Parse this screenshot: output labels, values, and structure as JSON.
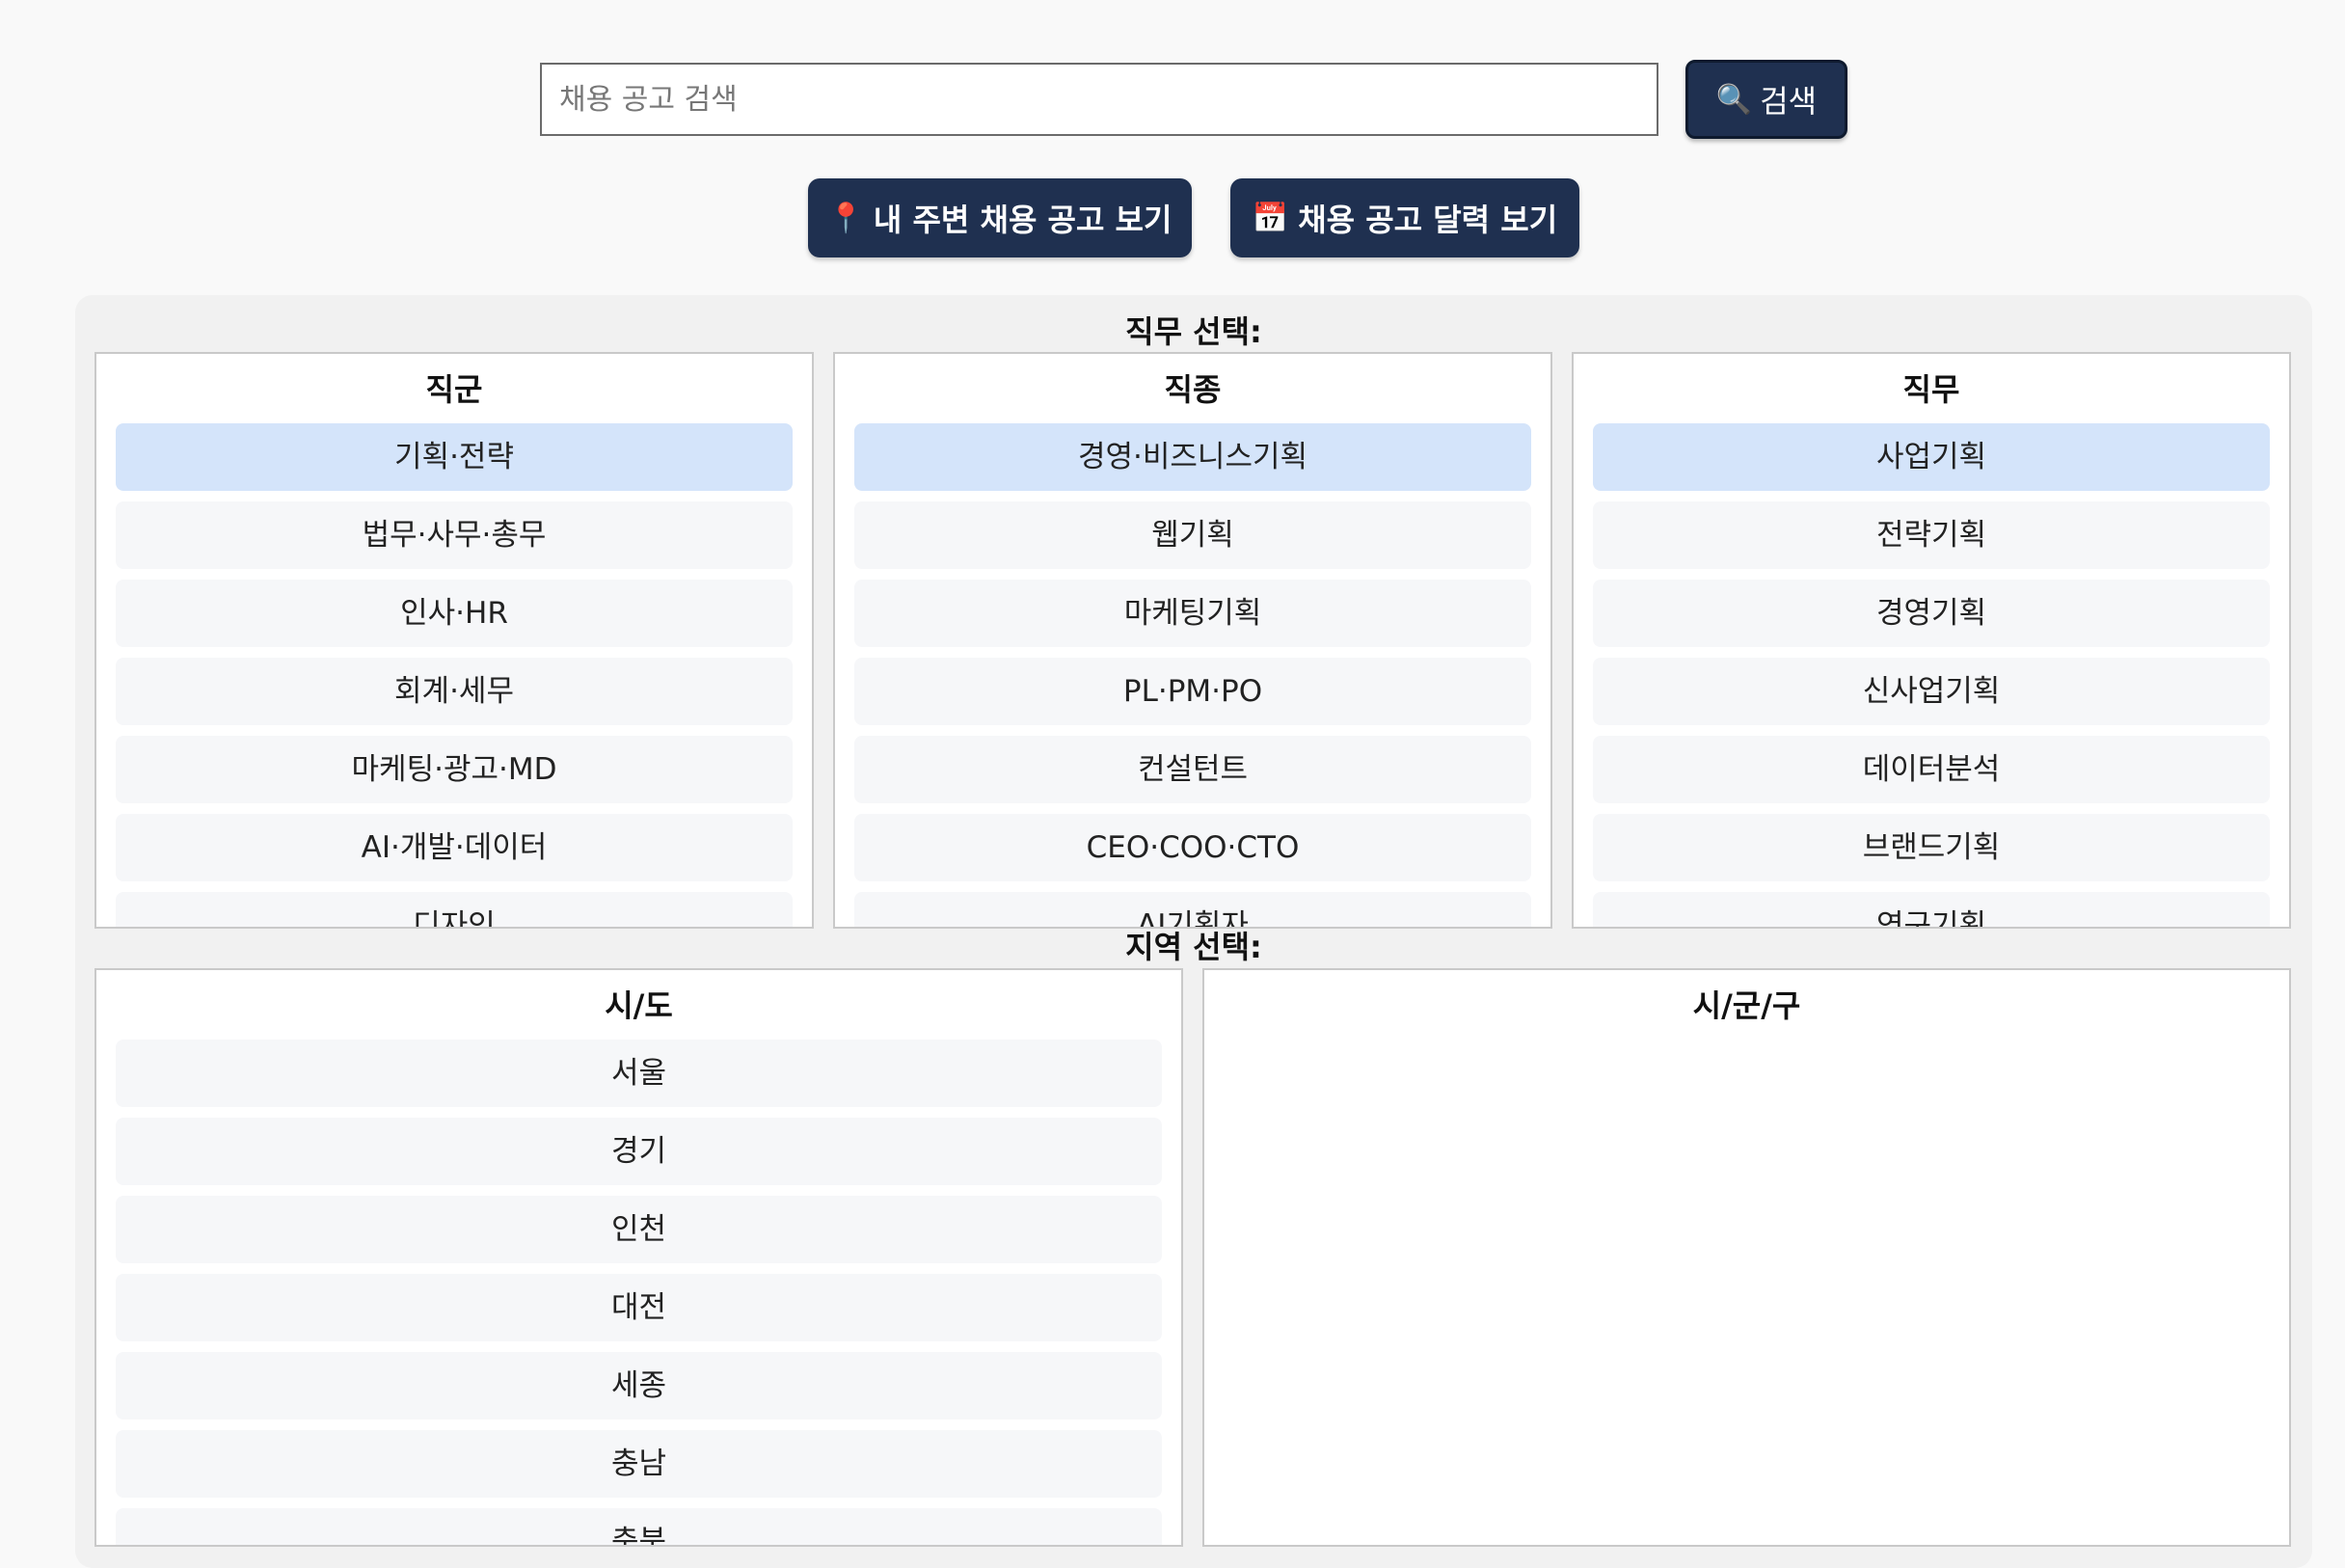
{
  "search": {
    "placeholder": "채용 공고 검색",
    "value": "",
    "button_icon": "🔍",
    "button_label": "검색"
  },
  "actions": {
    "nearby": {
      "icon": "📍",
      "label": "내 주변 채용 공고 보기"
    },
    "calendar": {
      "icon": "📅",
      "label": "채용 공고 달력 보기"
    }
  },
  "job_section": {
    "title": "직무 선택:",
    "columns": [
      {
        "header": "직군",
        "items": [
          "기획·전략",
          "법무·사무·총무",
          "인사·HR",
          "회계·세무",
          "마케팅·광고·MD",
          "AI·개발·데이터",
          "디자인"
        ],
        "selected": 0
      },
      {
        "header": "직종",
        "items": [
          "경영·비즈니스기획",
          "웹기획",
          "마케팅기획",
          "PL·PM·PO",
          "컨설턴트",
          "CEO·COO·CTO",
          "AI기획자"
        ],
        "selected": 0
      },
      {
        "header": "직무",
        "items": [
          "사업기획",
          "전략기획",
          "경영기획",
          "신사업기획",
          "데이터분석",
          "브랜드기획",
          "연구기획"
        ],
        "selected": 0
      }
    ]
  },
  "region_section": {
    "title": "지역 선택:",
    "columns": [
      {
        "header": "시/도",
        "items": [
          "서울",
          "경기",
          "인천",
          "대전",
          "세종",
          "충남",
          "충북"
        ]
      },
      {
        "header": "시/군/구",
        "items": []
      }
    ]
  },
  "colors": {
    "primary_button": "#1f3050",
    "selected_item": "#d4e4fa",
    "item_bg": "#f6f7f9",
    "panel_bg": "#f1f1f1"
  }
}
